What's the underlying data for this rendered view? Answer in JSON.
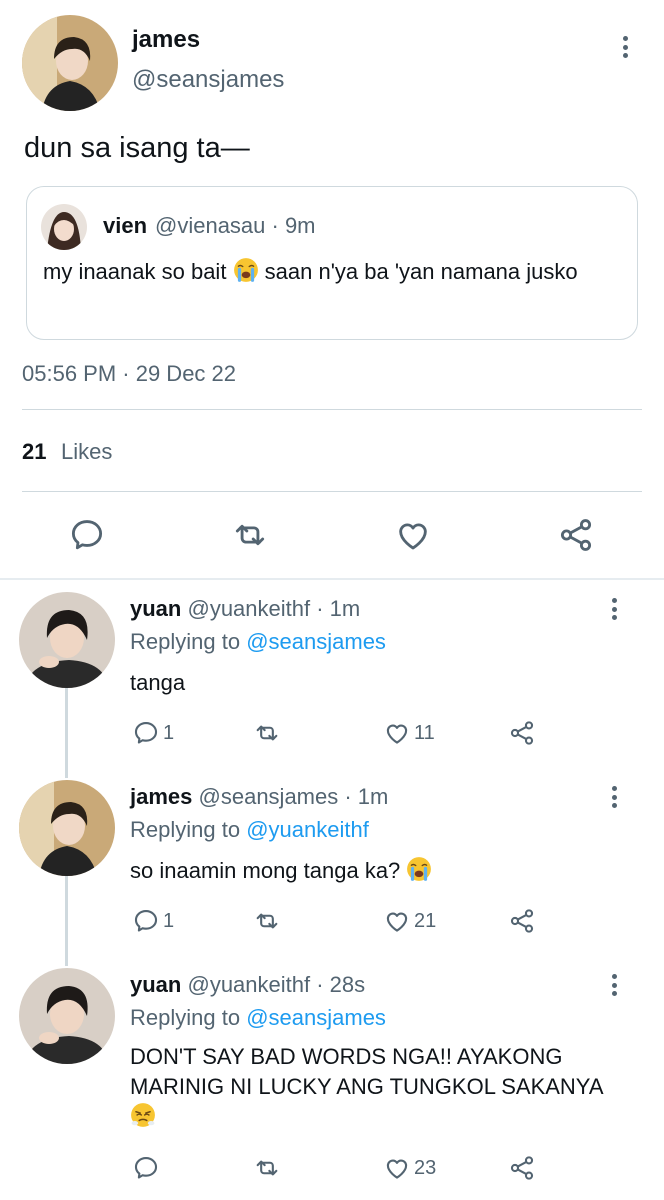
{
  "main_tweet": {
    "author_name": "james",
    "author_handle": "@seansjames",
    "text": "dun sa isang ta—",
    "quote": {
      "author_name": "vien",
      "meta": "@vienasau · 9m",
      "text_before_emoji": "my inaanak so bait",
      "text_after_emoji": " saan n'ya ba 'yan namana jusko",
      "emoji": "loudly-crying-face"
    },
    "timestamp": "05:56 PM · 29 Dec 22",
    "likes_count": "21",
    "likes_label": "Likes"
  },
  "replies": [
    {
      "author_name": "yuan",
      "meta": "@yuankeithf · 1m",
      "replying_prefix": "Replying to",
      "replying_to": "@seansjames",
      "text": "tanga",
      "reply_count": "1",
      "like_count": "11"
    },
    {
      "author_name": "james",
      "meta": "@seansjames · 1m",
      "replying_prefix": "Replying to",
      "replying_to": "@yuankeithf",
      "text": "so inaamin mong tanga ka? ",
      "emoji": "loudly-crying-face",
      "reply_count": "1",
      "like_count": "21"
    },
    {
      "author_name": "yuan",
      "meta": "@yuankeithf · 28s",
      "replying_prefix": "Replying to",
      "replying_to": "@seansjames",
      "text": "DON'T SAY BAD WORDS NGA!! AYAKONG MARINIG NI LUCKY ANG TUNGKOL SAKANYA ",
      "emoji": "face-with-steam-from-nose",
      "reply_count": "",
      "like_count": "23"
    }
  ],
  "colors": {
    "text": "#0f1419",
    "muted": "#536471",
    "link": "#1d9bf0",
    "divider": "#cfd9de"
  },
  "icons": [
    "more-vertical-icon",
    "reply-icon",
    "retweet-icon",
    "like-icon",
    "share-icon"
  ]
}
